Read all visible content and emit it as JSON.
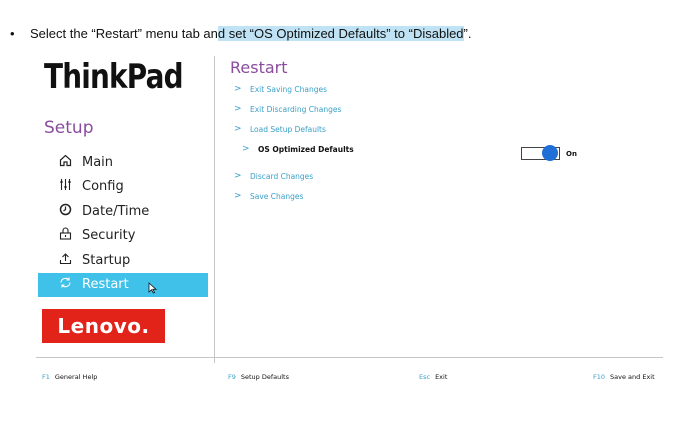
{
  "instruction": {
    "bullet": "•",
    "part1": "Select the “Restart” menu tab an",
    "part2": "d set “",
    "part3": "OS Optimized Defaults",
    "part4": "” to “",
    "part5": "Disabled",
    "part6": "”."
  },
  "sidebar": {
    "brand": "ThinkPad",
    "title": "Setup",
    "items": [
      {
        "label": "Main",
        "icon": "home-icon"
      },
      {
        "label": "Config",
        "icon": "sliders-icon"
      },
      {
        "label": "Date/Time",
        "icon": "clock-icon"
      },
      {
        "label": "Security",
        "icon": "lock-icon"
      },
      {
        "label": "Startup",
        "icon": "upload-icon"
      },
      {
        "label": "Restart",
        "icon": "restart-icon",
        "active": true
      }
    ],
    "logo": "Lenovo."
  },
  "main": {
    "title": "Restart",
    "items": [
      {
        "label": "Exit Saving Changes"
      },
      {
        "label": "Exit Discarding Changes"
      },
      {
        "label": "Load Setup Defaults"
      },
      {
        "label": "OS Optimized Defaults",
        "sub": true
      },
      {
        "label": "Discard Changes"
      },
      {
        "label": "Save Changes"
      }
    ],
    "toggle_label": "On"
  },
  "footer": [
    {
      "key": "F1",
      "label": "General Help"
    },
    {
      "key": "F9",
      "label": "Setup Defaults"
    },
    {
      "key": "Esc",
      "label": "Exit"
    },
    {
      "key": "F10",
      "label": "Save and Exit"
    }
  ],
  "colors": {
    "accent": "#3fc1ea",
    "link": "#3aa0c8",
    "title": "#8a4c9c",
    "toggle_on": "#1f6fd6",
    "lenovo_red": "#e2231a"
  }
}
